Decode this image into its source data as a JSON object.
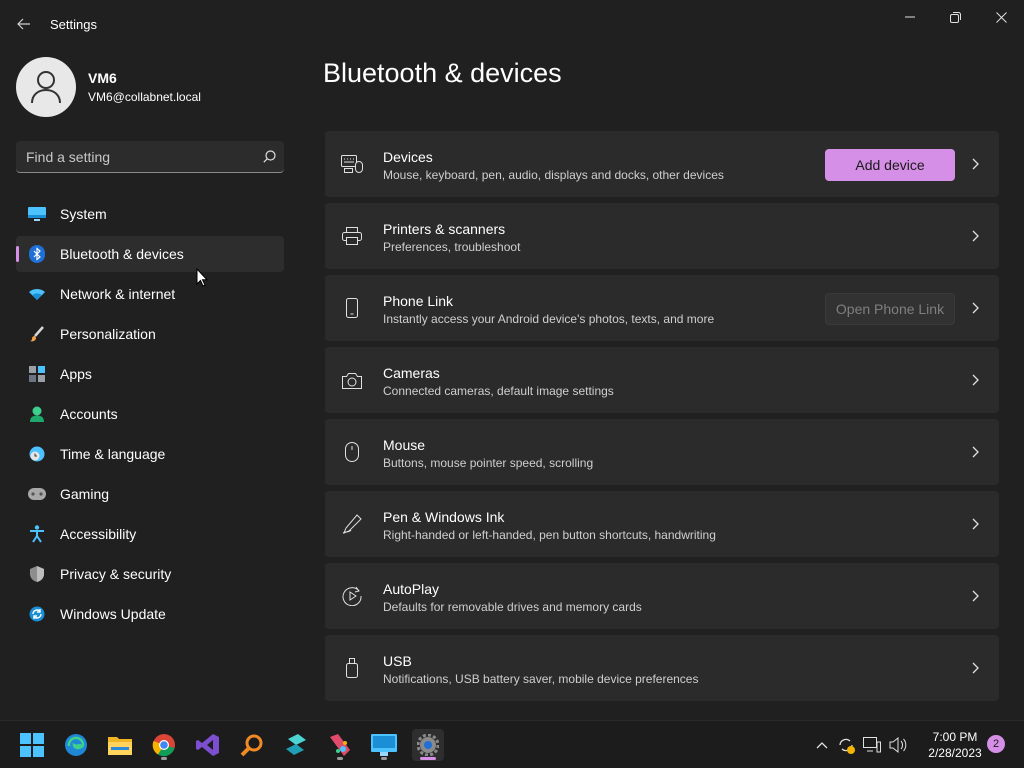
{
  "window": {
    "title": "Settings",
    "back_icon": "back-arrow-icon",
    "controls": [
      "minimize-icon",
      "restore-icon",
      "close-icon"
    ]
  },
  "profile": {
    "name": "VM6",
    "email": "VM6@collabnet.local",
    "avatar_icon": "person-icon"
  },
  "search": {
    "placeholder": "Find a setting",
    "icon": "search-icon"
  },
  "nav": {
    "items": [
      {
        "label": "System",
        "icon": "system-icon",
        "active": false
      },
      {
        "label": "Bluetooth & devices",
        "icon": "bluetooth-icon",
        "active": true
      },
      {
        "label": "Network & internet",
        "icon": "wifi-icon",
        "active": false
      },
      {
        "label": "Personalization",
        "icon": "brush-icon",
        "active": false
      },
      {
        "label": "Apps",
        "icon": "apps-icon",
        "active": false
      },
      {
        "label": "Accounts",
        "icon": "accounts-icon",
        "active": false
      },
      {
        "label": "Time & language",
        "icon": "clock-globe-icon",
        "active": false
      },
      {
        "label": "Gaming",
        "icon": "gamepad-icon",
        "active": false
      },
      {
        "label": "Accessibility",
        "icon": "accessibility-icon",
        "active": false
      },
      {
        "label": "Privacy & security",
        "icon": "shield-icon",
        "active": false
      },
      {
        "label": "Windows Update",
        "icon": "update-icon",
        "active": false
      }
    ]
  },
  "main": {
    "title": "Bluetooth & devices",
    "cards": [
      {
        "title": "Devices",
        "subtitle": "Mouse, keyboard, pen, audio, displays and docks, other devices",
        "icon": "devices-icon",
        "button": "Add device",
        "button_state": "accent"
      },
      {
        "title": "Printers & scanners",
        "subtitle": "Preferences, troubleshoot",
        "icon": "printer-icon"
      },
      {
        "title": "Phone Link",
        "subtitle": "Instantly access your Android device's photos, texts, and more",
        "icon": "phone-icon",
        "button": "Open Phone Link",
        "button_state": "disabled"
      },
      {
        "title": "Cameras",
        "subtitle": "Connected cameras, default image settings",
        "icon": "camera-icon"
      },
      {
        "title": "Mouse",
        "subtitle": "Buttons, mouse pointer speed, scrolling",
        "icon": "mouse-icon"
      },
      {
        "title": "Pen & Windows Ink",
        "subtitle": "Right-handed or left-handed, pen button shortcuts, handwriting",
        "icon": "pen-icon"
      },
      {
        "title": "AutoPlay",
        "subtitle": "Defaults for removable drives and memory cards",
        "icon": "autoplay-icon"
      },
      {
        "title": "USB",
        "subtitle": "Notifications, USB battery saver, mobile device preferences",
        "icon": "usb-icon"
      }
    ]
  },
  "taskbar": {
    "apps": [
      "start-icon",
      "edge-icon",
      "file-explorer-icon",
      "chrome-icon",
      "visual-studio-icon",
      "search-tool-icon",
      "app-icon",
      "paint-icon",
      "remote-desktop-icon",
      "settings-icon"
    ],
    "time": "7:00 PM",
    "date": "2/28/2023",
    "notification_count": "2"
  },
  "colors": {
    "accent": "#d68fe6",
    "background": "#202020",
    "card": "#2b2b2b"
  }
}
